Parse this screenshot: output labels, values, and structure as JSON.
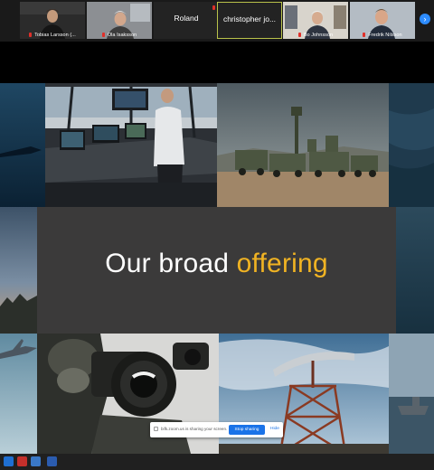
{
  "participants": [
    {
      "name": "Tobias Larsson (...",
      "muted": true
    },
    {
      "name": "Ola Isaksson",
      "muted": true
    },
    {
      "name": "Roland",
      "muted": true,
      "video": false
    },
    {
      "name": "christopher jo...",
      "muted": false,
      "video": false,
      "active": true
    },
    {
      "name": "Bo Johnsson",
      "muted": true
    },
    {
      "name": "Fredrik Nilsson",
      "muted": true
    }
  ],
  "slide": {
    "title_white": "Our broad",
    "title_accent": "offering",
    "accent_color": "#f0b323"
  },
  "share_bar": {
    "message": "bifk.zoom.us is sharing your screen.",
    "stop_label": "Stop sharing",
    "hide_label": "Hide"
  },
  "icons": {
    "next": "chevron-right-icon"
  }
}
